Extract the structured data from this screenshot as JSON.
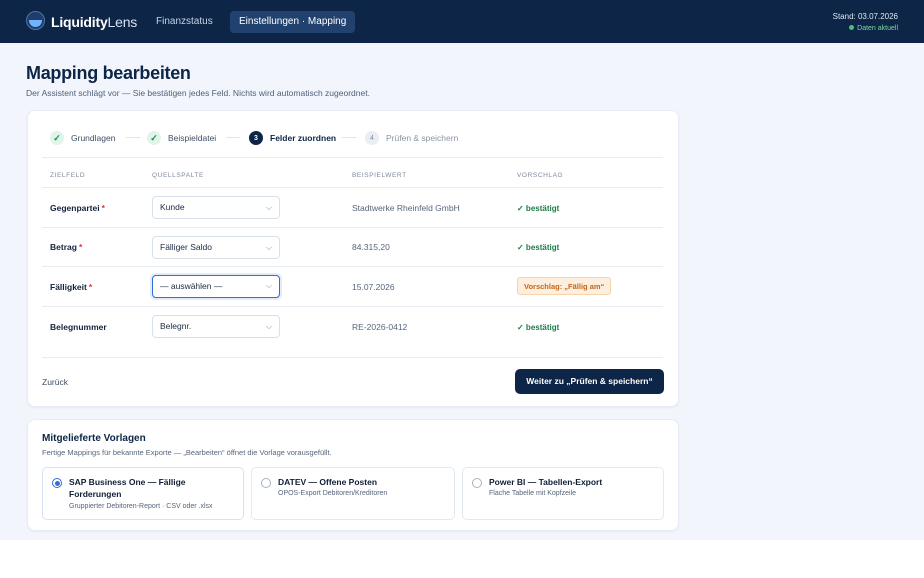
{
  "header": {
    "brand_bold": "Liquidity",
    "brand_light": "Lens",
    "nav": [
      "Finanzstatus",
      "Einstellungen · Mapping"
    ],
    "stand": "Stand: 03.07.2026",
    "status": "Daten aktuell"
  },
  "page": {
    "title": "Mapping bearbeiten",
    "subtitle": "Der Assistent schlägt vor — Sie bestätigen jedes Feld. Nichts wird automatisch zugeordnet."
  },
  "stepper": [
    {
      "label": "Grundlagen",
      "state": "done",
      "marker": "✓"
    },
    {
      "label": "Beispieldatei",
      "state": "done",
      "marker": "✓"
    },
    {
      "label": "Felder zuordnen",
      "state": "active",
      "marker": "3"
    },
    {
      "label": "Prüfen & speichern",
      "state": "todo",
      "marker": "4"
    }
  ],
  "table": {
    "headers": [
      "ZIELFELD",
      "QUELLSPALTE",
      "BEISPIELWERT",
      "VORSCHLAG"
    ],
    "required_marker": "*",
    "rows": [
      {
        "field": "Gegenpartei",
        "required": true,
        "source": "Kunde",
        "example": "Stadtwerke Rheinfeld GmbH",
        "status": "✓ bestätigt"
      },
      {
        "field": "Betrag",
        "required": true,
        "source": "Fälliger Saldo",
        "example": "84.315,20",
        "status": "✓ bestätigt"
      },
      {
        "field": "Fälligkeit",
        "required": true,
        "source": "— auswählen —",
        "example": "15.07.2026",
        "status": "Vorschlag: „Fällig am“"
      },
      {
        "field": "Belegnummer",
        "required": false,
        "source": "Belegnr.",
        "example": "RE-2026-0412",
        "status": "✓ bestätigt"
      }
    ]
  },
  "actions": {
    "back": "Zurück",
    "next": "Weiter zu „Prüfen & speichern“"
  },
  "templates": {
    "title": "Mitgelieferte Vorlagen",
    "subtitle": "Fertige Mappings für bekannte Exporte — „Bearbeiten“ öffnet die Vorlage vorausgefüllt.",
    "items": [
      {
        "name": "SAP Business One — Fällige Forderungen",
        "desc": "Gruppierter Debitoren-Report · CSV oder .xlsx",
        "selected": true
      },
      {
        "name": "DATEV — Offene Posten",
        "desc": "OPOS-Export Debitoren/Kreditoren",
        "selected": false
      },
      {
        "name": "Power BI — Tabellen-Export",
        "desc": "Flache Tabelle mit Kopfzeile",
        "selected": false
      }
    ]
  },
  "icons": {
    "check": "check-icon",
    "chevron": "chevron-down-icon",
    "logo": "liquidity-lens-logo-icon"
  },
  "colors": {
    "navy": "#0d2547",
    "confirmed": "#1d7a45",
    "suggestion": "#c4661a",
    "focus": "#2f6fd6",
    "required": "#d8343b"
  }
}
